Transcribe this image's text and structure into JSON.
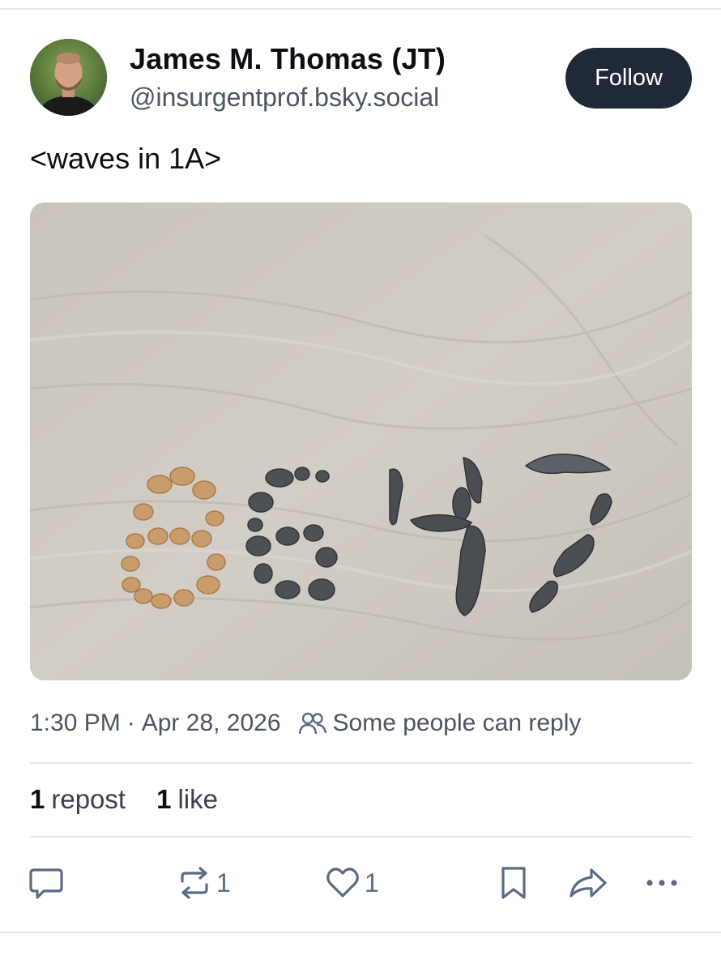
{
  "author": {
    "display_name": "James M. Thomas (JT)",
    "handle": "@insurgentprof.bsky.social",
    "follow_label": "Follow"
  },
  "post": {
    "text": "<waves in 1A>",
    "image_text": "8647",
    "timestamp": "1:30 PM",
    "separator": "·",
    "date": "Apr 28, 2026",
    "reply_setting": "Some people can reply"
  },
  "stats": {
    "reposts_count": "1",
    "reposts_label": "repost",
    "likes_count": "1",
    "likes_label": "like"
  },
  "actions": {
    "reply_icon": "reply-icon",
    "repost_icon": "repost-icon",
    "repost_count": "1",
    "like_icon": "heart-icon",
    "like_count": "1",
    "bookmark_icon": "bookmark-icon",
    "share_icon": "share-icon",
    "more_icon": "more-icon"
  },
  "colors": {
    "follow_bg": "#1f2937",
    "action_icon": "#5b6b86",
    "sand": "#cdc8bf"
  }
}
